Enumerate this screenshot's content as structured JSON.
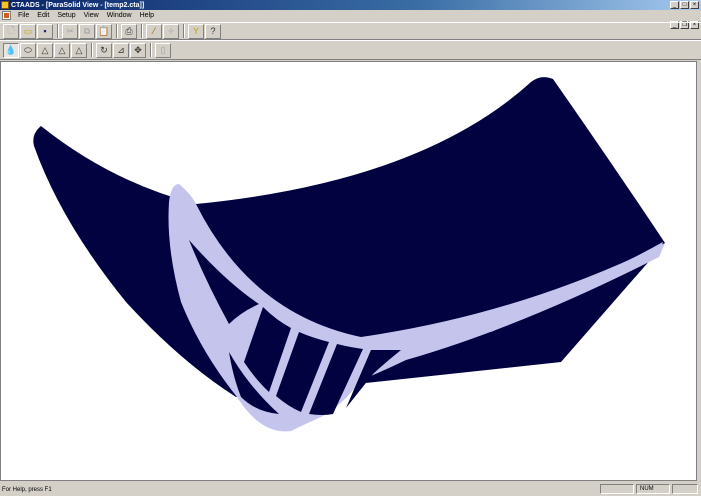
{
  "window": {
    "title": "CTAADS - [ParaSolid View - [temp2.cta]]",
    "minimize": "_",
    "maximize": "□",
    "close": "×"
  },
  "menu": {
    "items": [
      "File",
      "Edit",
      "Setup",
      "View",
      "Window",
      "Help"
    ],
    "mdi_minimize": "_",
    "mdi_restore": "❐",
    "mdi_close": "×"
  },
  "toolbar1": {
    "icons": [
      "new-icon",
      "open-icon",
      "save-icon",
      "cut-icon",
      "copy-icon",
      "paste-icon",
      "print-icon",
      "wand-icon",
      "filter-icon",
      "help-icon"
    ]
  },
  "toolbar2": {
    "icons": [
      "shaded-view-icon",
      "ellipse-view-icon",
      "cone-view-icon",
      "triangle-view-icon",
      "triangle-outline-view-icon",
      "rotate-icon",
      "scale-icon",
      "pan-icon",
      "zoom-fit-icon"
    ]
  },
  "viewport": {
    "colors": {
      "dark_surface": "#020240",
      "light_surface": "#c4c4ec",
      "background": "#ffffff"
    }
  },
  "status": {
    "message": "For Help, press F1",
    "num": "NUM"
  }
}
